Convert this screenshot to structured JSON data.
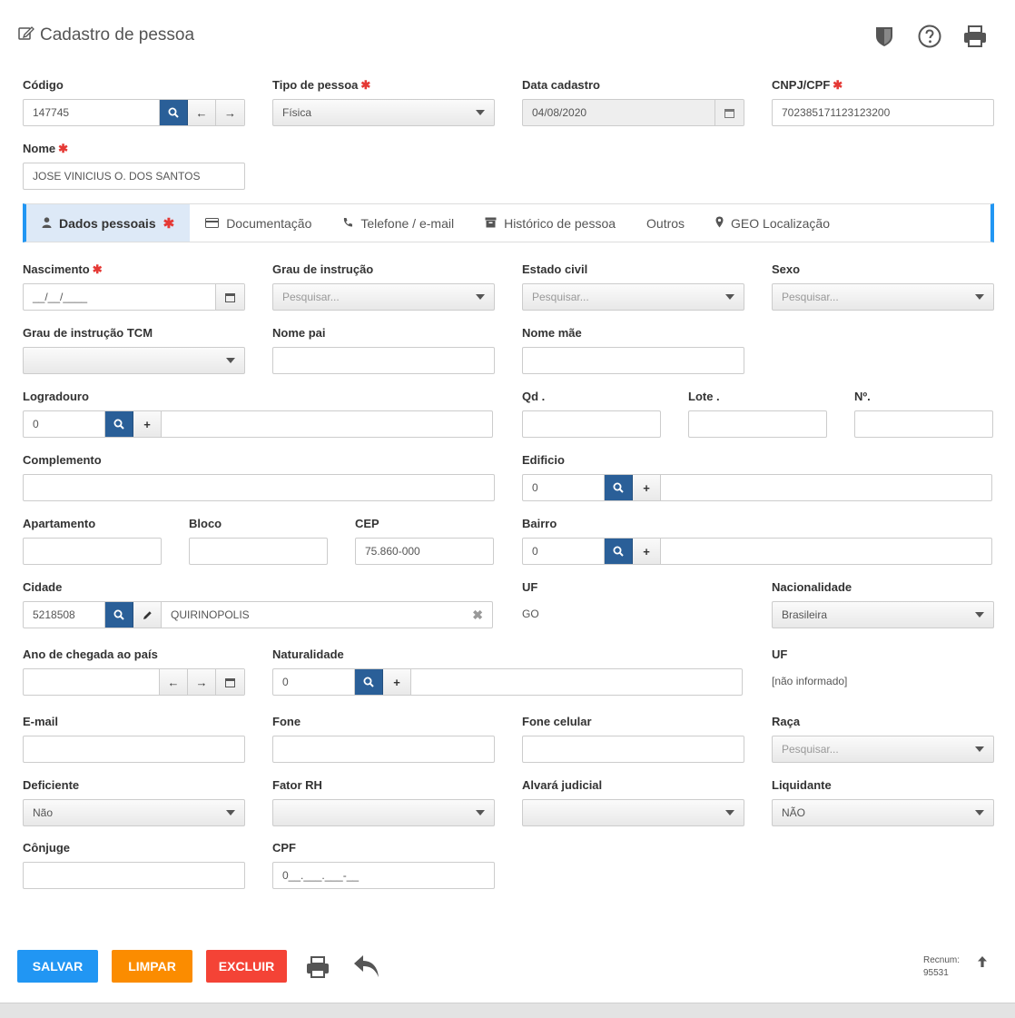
{
  "header": {
    "title": "Cadastro de pessoa",
    "icons": [
      "edit-icon",
      "shield-icon",
      "help-icon",
      "print-icon"
    ]
  },
  "top": {
    "codigo": {
      "label": "Código",
      "value": "147745"
    },
    "tipo_pessoa": {
      "label": "Tipo de pessoa",
      "value": "Física"
    },
    "data_cadastro": {
      "label": "Data cadastro",
      "value": "04/08/2020"
    },
    "cnpj_cpf": {
      "label": "CNPJ/CPF",
      "value": "702385171123123200"
    },
    "nome": {
      "label": "Nome",
      "value": "JOSE VINICIUS O. DOS SANTOS"
    },
    "required_mark": "✱"
  },
  "tabs": [
    {
      "label": "Dados pessoais",
      "icon": "user-icon"
    },
    {
      "label": "Documentação",
      "icon": "card-icon"
    },
    {
      "label": "Telefone / e-mail",
      "icon": "phone-icon"
    },
    {
      "label": "Histórico de pessoa",
      "icon": "archive-icon"
    },
    {
      "label": "Outros",
      "icon": ""
    },
    {
      "label": "GEO Localização",
      "icon": "map-marker-icon"
    }
  ],
  "form": {
    "nascimento": {
      "label": "Nascimento",
      "value": "__/__/____"
    },
    "grau_instrucao": {
      "label": "Grau de instrução",
      "placeholder": "Pesquisar..."
    },
    "estado_civil": {
      "label": "Estado civil",
      "placeholder": "Pesquisar..."
    },
    "sexo": {
      "label": "Sexo",
      "placeholder": "Pesquisar..."
    },
    "grau_instrucao_tcm": {
      "label": "Grau de instrução TCM",
      "value": ""
    },
    "nome_pai": {
      "label": "Nome pai",
      "value": ""
    },
    "nome_mae": {
      "label": "Nome mãe",
      "value": ""
    },
    "logradouro": {
      "label": "Logradouro",
      "value": "0"
    },
    "qd": {
      "label": "Qd .",
      "value": ""
    },
    "lote": {
      "label": "Lote .",
      "value": ""
    },
    "numero": {
      "label": "Nº.",
      "value": ""
    },
    "complemento": {
      "label": "Complemento",
      "value": ""
    },
    "edificio": {
      "label": "Edificio",
      "value": "0"
    },
    "apartamento": {
      "label": "Apartamento",
      "value": ""
    },
    "bloco": {
      "label": "Bloco",
      "value": ""
    },
    "cep": {
      "label": "CEP",
      "value": "75.860-000"
    },
    "bairro": {
      "label": "Bairro",
      "value": "0"
    },
    "cidade": {
      "label": "Cidade",
      "code": "5218508",
      "name": "QUIRINOPOLIS"
    },
    "uf": {
      "label": "UF",
      "value": "GO"
    },
    "nacionalidade": {
      "label": "Nacionalidade",
      "value": "Brasileira"
    },
    "ano_chegada": {
      "label": "Ano de chegada ao país",
      "value": ""
    },
    "naturalidade": {
      "label": "Naturalidade",
      "value": "0"
    },
    "uf2": {
      "label": "UF",
      "value": "[não informado]"
    },
    "email": {
      "label": "E-mail",
      "value": ""
    },
    "fone": {
      "label": "Fone",
      "value": ""
    },
    "fone_celular": {
      "label": "Fone celular",
      "value": ""
    },
    "raca": {
      "label": "Raça",
      "placeholder": "Pesquisar..."
    },
    "deficiente": {
      "label": "Deficiente",
      "value": "Não"
    },
    "fator_rh": {
      "label": "Fator RH",
      "value": ""
    },
    "alvara": {
      "label": "Alvará judicial",
      "value": ""
    },
    "liquidante": {
      "label": "Liquidante",
      "value": "NÃO"
    },
    "conjuge": {
      "label": "Cônjuge",
      "value": ""
    },
    "cpf": {
      "label": "CPF",
      "value": "0__.___.___-__"
    }
  },
  "footer": {
    "salvar": "SALVAR",
    "limpar": "LIMPAR",
    "excluir": "EXCLUIR",
    "recnum_label": "Recnum:",
    "recnum_value": "95531",
    "colors": {
      "salvar": "#2196f3",
      "limpar": "#fb8c00",
      "excluir": "#f44336"
    }
  }
}
